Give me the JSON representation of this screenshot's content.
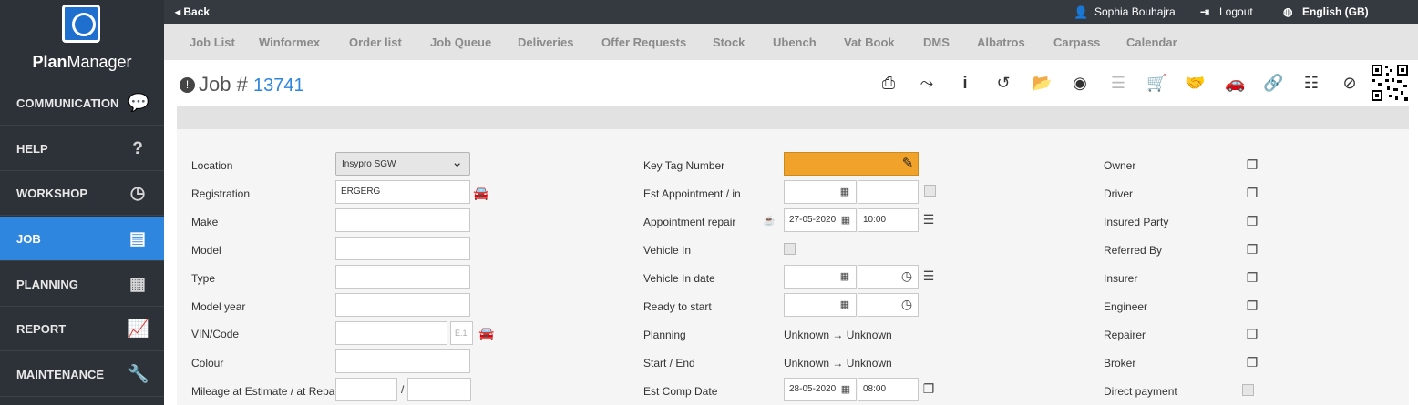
{
  "app": {
    "name_bold": "Plan",
    "name_rest": "Manager"
  },
  "nav": [
    {
      "label": "COMMUNICATION",
      "icon": "chat-icon"
    },
    {
      "label": "HELP",
      "icon": "question-icon"
    },
    {
      "label": "WORKSHOP",
      "icon": "clock-icon"
    },
    {
      "label": "JOB",
      "icon": "document-icon"
    },
    {
      "label": "PLANNING",
      "icon": "calendar-icon"
    },
    {
      "label": "REPORT",
      "icon": "chart-icon"
    },
    {
      "label": "MAINTENANCE",
      "icon": "wrench-icon"
    }
  ],
  "topbar": {
    "back": "◂ Back",
    "user": "Sophia Bouhajra",
    "logout": "Logout",
    "language": "English (GB)"
  },
  "tabs": [
    "Job List",
    "Winformex",
    "Order list",
    "Job Queue",
    "Deliveries",
    "Offer Requests",
    "Stock",
    "Ubench",
    "Vat Book",
    "DMS",
    "Albatros",
    "Carpass",
    "Calendar"
  ],
  "job": {
    "prefix": "Job #",
    "number": "13741"
  },
  "colors": {
    "accent": "#2f86df",
    "key_tag": "#f0a22b",
    "sidebar": "#2d3238"
  },
  "left": {
    "location_label": "Location",
    "location_value": "Insypro SGW",
    "registration_label": "Registration",
    "registration_value": "ERGERG",
    "make_label": "Make",
    "model_label": "Model",
    "type_label": "Type",
    "model_year_label": "Model year",
    "vin_label_u": "VIN",
    "vin_label_rest": "/Code",
    "vin_placeholder": "E.1",
    "colour_label": "Colour",
    "mileage_label": "Mileage at Estimate / at Repair",
    "mileage_sep": "/"
  },
  "middle": {
    "key_tag_label": "Key Tag Number",
    "est_appointment_label": "Est Appointment / in",
    "appointment_repair_label": "Appointment repair",
    "appointment_date": "27-05-2020",
    "appointment_time": "10:00",
    "vehicle_in_label": "Vehicle In",
    "vehicle_in_date_label": "Vehicle In date",
    "ready_label": "Ready to start",
    "planning_label": "Planning",
    "planning_value": "Unknown → Unknown",
    "start_end_label": "Start / End",
    "start_end_value": "Unknown → Unknown",
    "est_comp_label": "Est Comp Date",
    "est_comp_date": "28-05-2020",
    "est_comp_time": "08:00"
  },
  "right": [
    "Owner",
    "Driver",
    "Insured Party",
    "Referred By",
    "Insurer",
    "Engineer",
    "Repairer",
    "Broker",
    "Direct payment"
  ]
}
